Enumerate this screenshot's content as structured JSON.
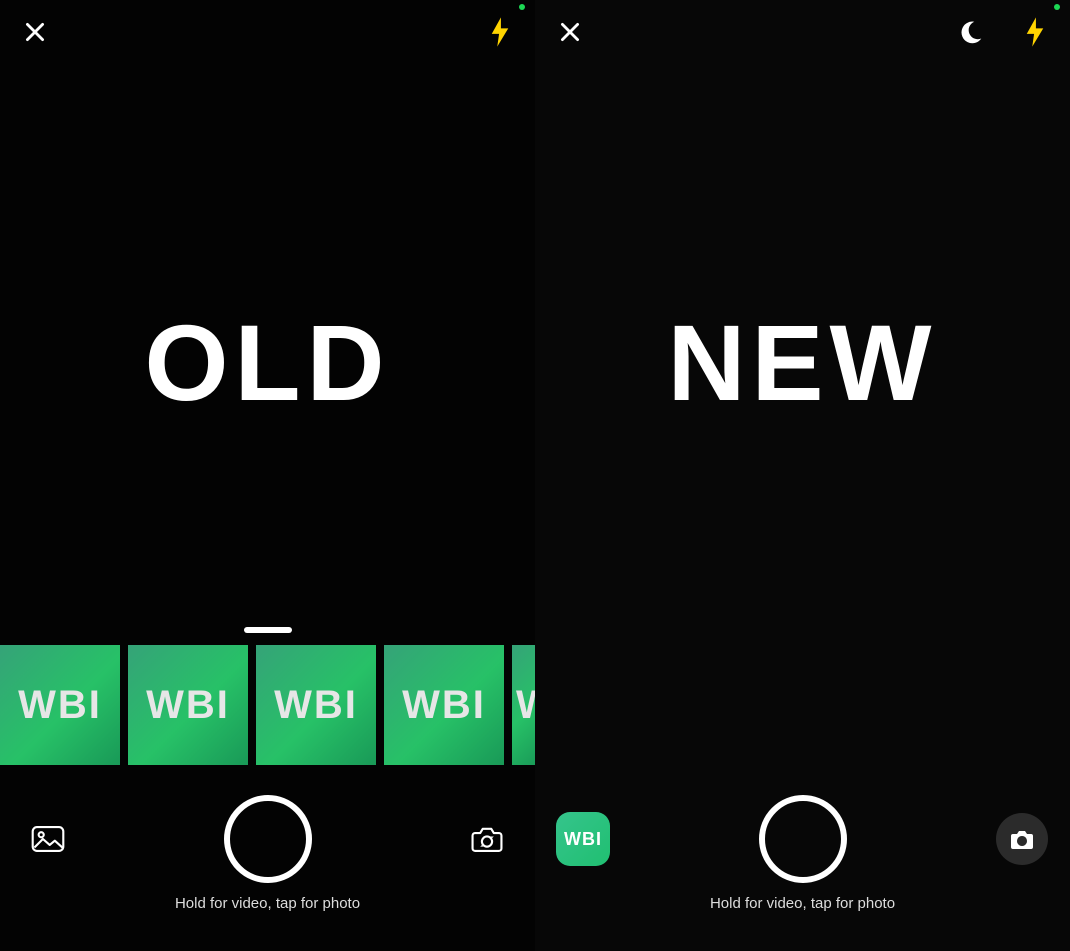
{
  "left": {
    "label": "OLD",
    "hint": "Hold for video, tap for photo",
    "thumbs": [
      "WBI",
      "WBI",
      "WBI",
      "WBI",
      "W"
    ]
  },
  "right": {
    "label": "NEW",
    "hint": "Hold for video, tap for photo",
    "gallery_chip": "WBI"
  },
  "colors": {
    "flash": "#FFD400",
    "thumb_text": "#e6e6e6",
    "thumb_bg_a": "#35a378",
    "thumb_bg_b": "#199957",
    "chip_bg": "#20bf71"
  },
  "icons": {
    "close": "close-icon",
    "flash": "flash-icon",
    "moon": "moon-icon",
    "gallery": "gallery-icon",
    "swap": "camera-swap-icon"
  }
}
